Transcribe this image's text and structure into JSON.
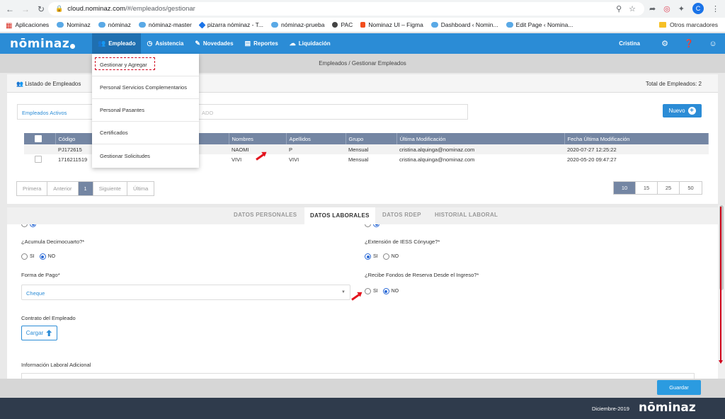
{
  "browser": {
    "url_host": "cloud.nominaz.com",
    "url_path": "/#/empleados/gestionar",
    "bookmarks": [
      "Aplicaciones",
      "Nominaz",
      "nóminaz",
      "nóminaz-master",
      "pizarra nóminaz - T...",
      "nóminaz-prueba",
      "PAC",
      "Nominaz UI – Figma",
      "Dashboard ‹ Nomin...",
      "Edit Page ‹ Nomina..."
    ],
    "other_bookmarks": "Otros marcadores",
    "profile_initial": "C"
  },
  "header": {
    "logo": "nōminaz",
    "menu": [
      {
        "label": "Empleado",
        "icon": "users-icon"
      },
      {
        "label": "Asistencia",
        "icon": "clock-icon"
      },
      {
        "label": "Novedades",
        "icon": "edit-icon"
      },
      {
        "label": "Reportes",
        "icon": "bar-chart-icon"
      },
      {
        "label": "Liquidación",
        "icon": "cloud-icon"
      }
    ],
    "user": "Cristina"
  },
  "dropdown": [
    "Gestionar y Agregar",
    "Personal Servicios Complementarios",
    "Personal Pasantes",
    "Certificados",
    "Gestionar Solicitudes"
  ],
  "breadcrumb": "Empleados / Gestionar Empleados",
  "list": {
    "title": "Listado de Empleados",
    "total": "Total de Empleados: 2",
    "filter": "Empleados Activos",
    "search_placeholder": "ADO",
    "new_button": "Nuevo",
    "columns": [
      "Código",
      "",
      "Nombres",
      "Apellidos",
      "Grupo",
      "Última Modificación",
      "Fecha Última Modificación"
    ],
    "rows": [
      [
        "PJ172615",
        "",
        "NAOMI",
        "P",
        "Mensual",
        "cristina.alquinga@nominaz.com",
        "2020-07-27 12:25:22"
      ],
      [
        "1716211519",
        "",
        "VIVI",
        "VIVI",
        "Mensual",
        "cristina.alquinga@nominaz.com",
        "2020-05-20 09:47:27"
      ]
    ],
    "pager": [
      "Primera",
      "Anterior",
      "1",
      "Siguiente",
      "Última"
    ],
    "page_sizes": [
      "10",
      "15",
      "25",
      "50"
    ]
  },
  "tabs": [
    "DATOS PERSONALES",
    "DATOS LABORALES",
    "DATOS RDEP",
    "HISTORIAL LABORAL"
  ],
  "form": {
    "decimocuarto_label": "¿Acumula Decimocuarto?*",
    "extension_label": "¿Extensión de IESS Cónyuge?*",
    "forma_pago_label": "Forma de Pago*",
    "forma_pago_value": "Cheque",
    "fondos_label": "¿Recibe Fondos de Reserva Desde el Ingreso?*",
    "contrato_label": "Contrato del Empleado",
    "cargar_button": "Cargar",
    "info_label": "Información Laboral Adicional",
    "si": "SI",
    "no": "NO"
  },
  "save_button": "Guardar",
  "footer": {
    "date": "Diciembre-2019",
    "logo": "nōminaz"
  }
}
